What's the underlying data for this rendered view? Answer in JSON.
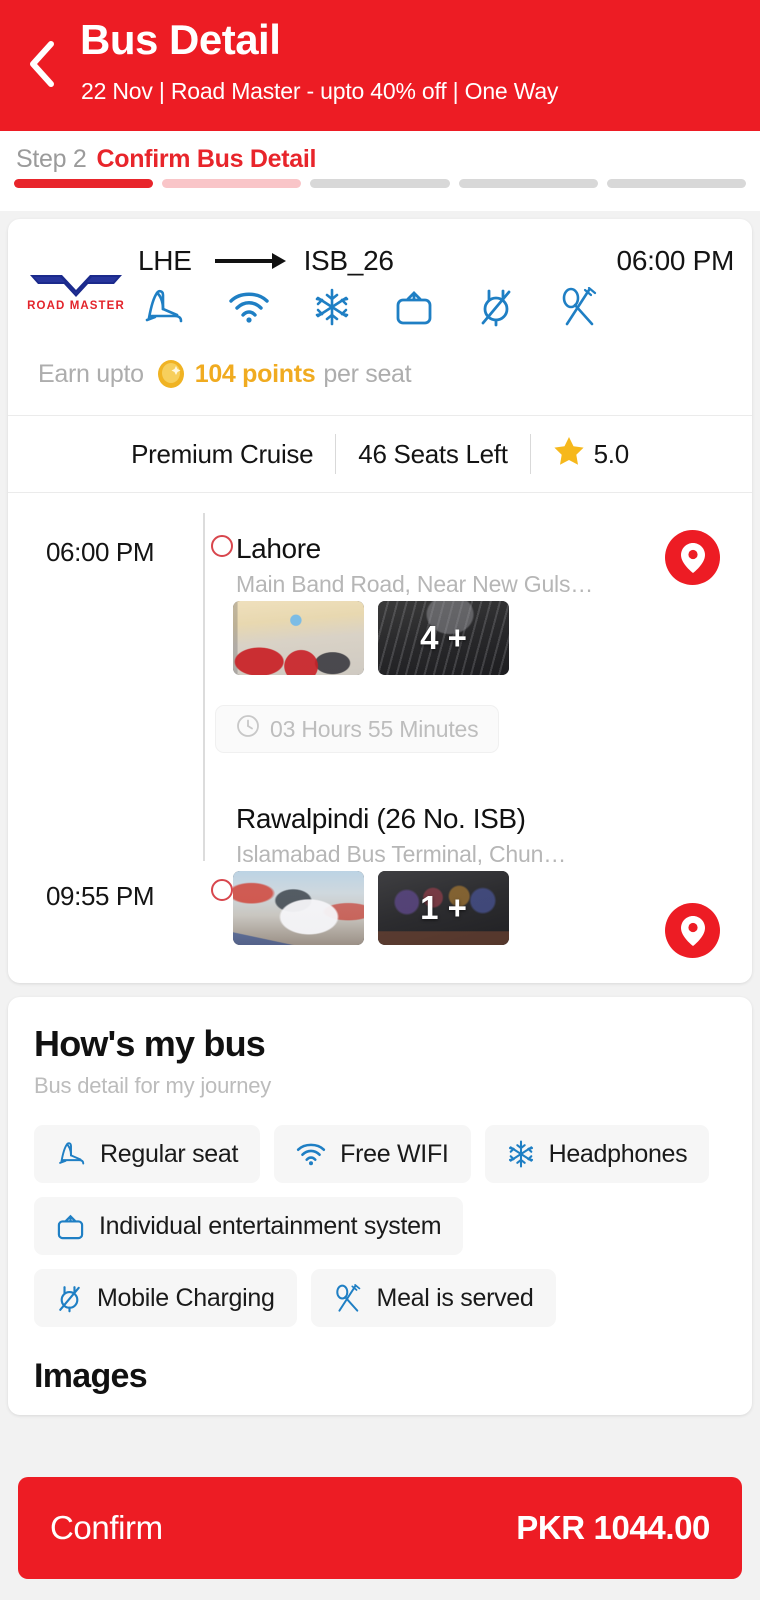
{
  "header": {
    "back_icon": "chevron-left-icon",
    "title": "Bus Detail",
    "subtitle": "22 Nov | Road Master - upto 40% off | One Way",
    "background_color": "#ED1C24"
  },
  "stepper": {
    "step_number": "Step 2",
    "step_label": "Confirm Bus Detail",
    "total_steps": 5,
    "current_step": 2,
    "active_color": "#E8252B",
    "half_color": "#F9C5C8",
    "inactive_color": "#D8D8D8"
  },
  "bus": {
    "operator_logo_text": "ROAD MASTER",
    "origin_code": "LHE",
    "arrow_icon": "arrow-right-icon",
    "destination_code": "ISB_26",
    "departure_time": "06:00 PM",
    "amenity_icons": [
      "seat-icon",
      "wifi-icon",
      "snowflake-icon",
      "tv-icon",
      "power-plug-icon",
      "cutlery-icon"
    ],
    "earn": {
      "prefix": "Earn upto",
      "coin_icon": "coin-icon",
      "points": "104 points",
      "suffix": "per seat",
      "points_color": "#F0AB20"
    },
    "meta": {
      "class_name": "Premium Cruise",
      "seats_left": "46 Seats Left",
      "star_icon": "star-icon",
      "rating": "5.0"
    }
  },
  "timeline": {
    "stops": [
      {
        "time": "06:00 PM",
        "name": "Lahore",
        "address": "Main Band Road, Near New Guls…",
        "thumb_overlay": "4 +",
        "pin_icon": "map-pin-icon"
      },
      {
        "time": "09:55 PM",
        "name": "Rawalpindi (26 No. ISB)",
        "address": "Islamabad Bus Terminal, Chun…",
        "thumb_overlay": "1 +",
        "pin_icon": "map-pin-icon"
      }
    ],
    "duration": {
      "clock_icon": "clock-icon",
      "text": "03 Hours 55 Minutes"
    }
  },
  "hows_my_bus": {
    "title": "How's my bus",
    "subtitle": "Bus detail for my journey",
    "amenities": [
      {
        "icon": "seat-icon",
        "label": "Regular seat"
      },
      {
        "icon": "wifi-icon",
        "label": "Free WIFI"
      },
      {
        "icon": "snowflake-icon",
        "label": "Headphones"
      },
      {
        "icon": "tv-icon",
        "label": "Individual entertainment system"
      },
      {
        "icon": "power-plug-icon",
        "label": "Mobile Charging"
      },
      {
        "icon": "cutlery-icon",
        "label": "Meal is served"
      }
    ],
    "images_title": "Images"
  },
  "confirm_bar": {
    "label": "Confirm",
    "amount": "PKR 1044.00",
    "background_color": "#ED1C24"
  }
}
